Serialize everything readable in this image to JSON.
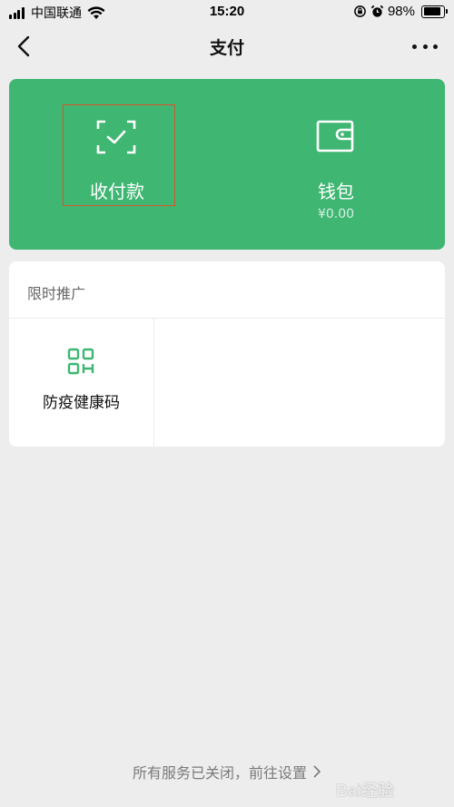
{
  "status_bar": {
    "carrier": "中国联通",
    "time": "15:20",
    "battery": "98%",
    "battery_level": 0.98
  },
  "nav": {
    "title": "支付"
  },
  "pay_card": {
    "background": "#3fb672",
    "collect_label": "收付款",
    "wallet_label": "钱包",
    "wallet_amount": "¥0.00"
  },
  "promo": {
    "header": "限时推广",
    "items": [
      {
        "label": "防疫健康码",
        "icon": "health-code-icon",
        "icon_color": "#3fb672"
      }
    ]
  },
  "footer": {
    "text": "所有服务已关闭，前往设置"
  },
  "watermark": {
    "text": "Bai经验"
  }
}
